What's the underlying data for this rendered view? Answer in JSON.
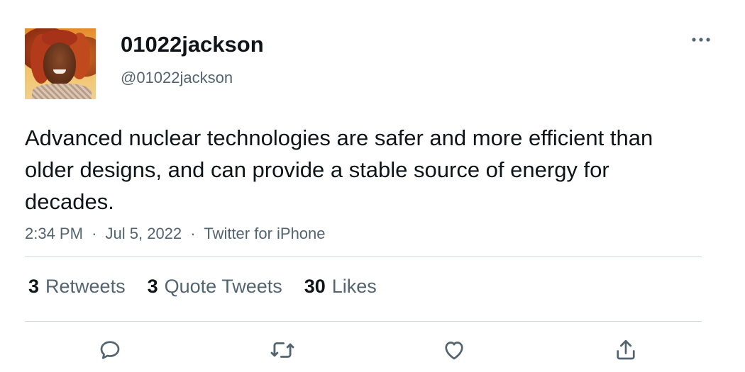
{
  "user": {
    "display_name": "01022jackson",
    "handle": "@01022jackson"
  },
  "tweet": {
    "text": "Advanced nuclear technologies are safer and more efficient than older designs, and can provide a stable source of energy for decades.",
    "time": "2:34 PM",
    "date": "Jul 5, 2022",
    "source": "Twitter for iPhone",
    "separator": "·"
  },
  "stats": {
    "retweets_count": "3",
    "retweets_label": "Retweets",
    "quotes_count": "3",
    "quotes_label": "Quote Tweets",
    "likes_count": "30",
    "likes_label": "Likes"
  },
  "icons": {
    "more": "more-icon",
    "reply": "reply-icon",
    "retweet": "retweet-icon",
    "like": "like-icon",
    "share": "share-icon"
  },
  "colors": {
    "text_primary": "#0f1419",
    "text_secondary": "#536471",
    "divider": "#cfd9de"
  }
}
